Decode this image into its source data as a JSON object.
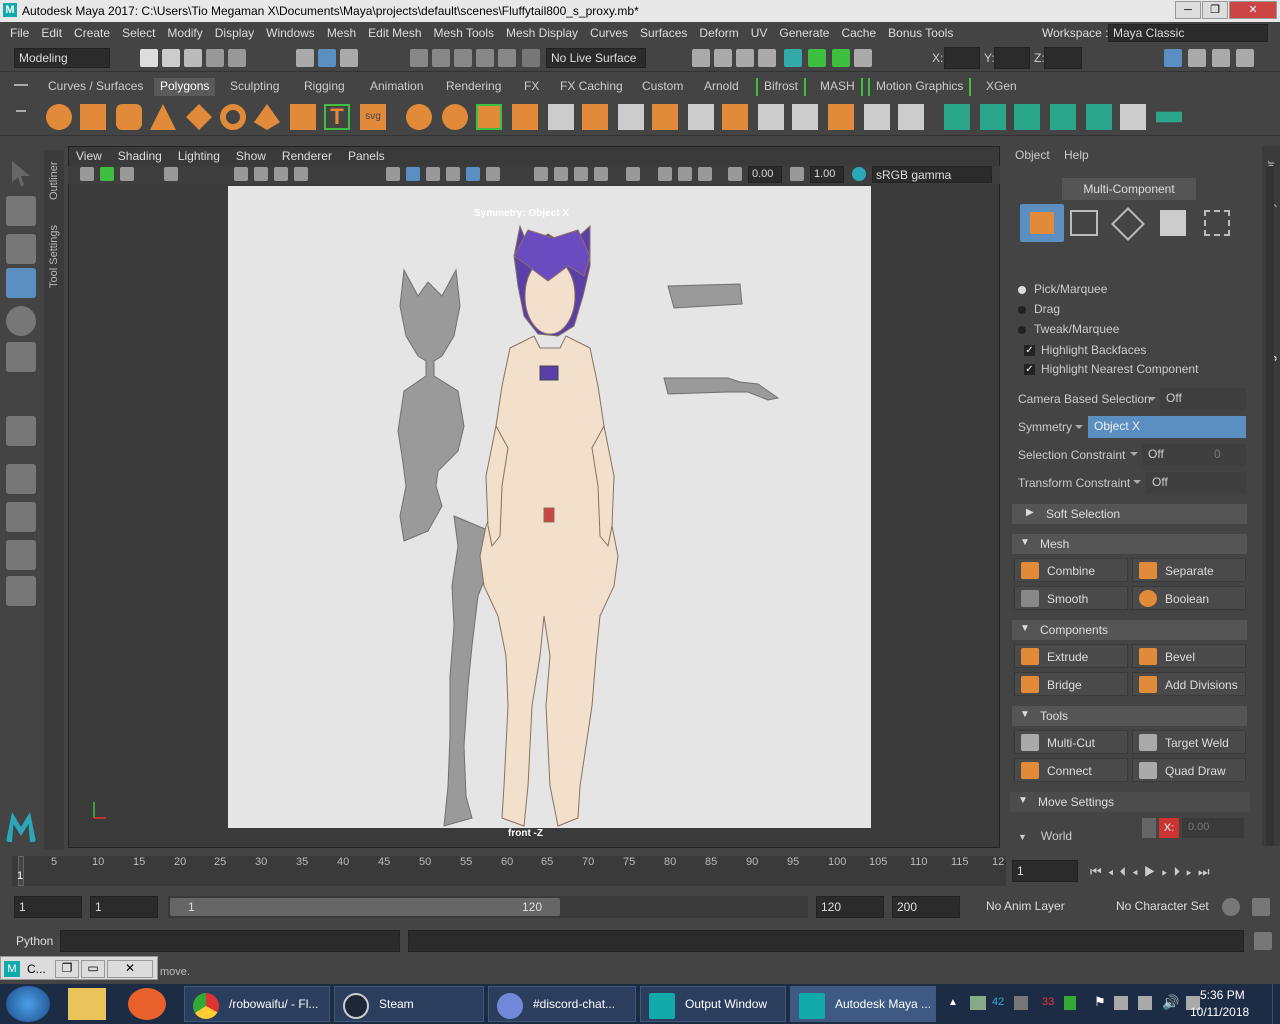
{
  "window": {
    "title": "Autodesk Maya 2017: C:\\Users\\Tio Megaman X\\Documents\\Maya\\projects\\default\\scenes\\Fluffytail800_s_proxy.mb*",
    "app_icon": "M"
  },
  "menu": [
    "File",
    "Edit",
    "Create",
    "Select",
    "Modify",
    "Display",
    "Windows",
    "Mesh",
    "Edit Mesh",
    "Mesh Tools",
    "Mesh Display",
    "Curves",
    "Surfaces",
    "Deform",
    "UV",
    "Generate",
    "Cache",
    "Bonus Tools"
  ],
  "workspace": {
    "label": "Workspace :",
    "value": "Maya Classic"
  },
  "status": {
    "mode": "Modeling",
    "live_surface": "No Live Surface",
    "x_label": "X:",
    "y_label": "Y:",
    "z_label": "Z:"
  },
  "shelf_tabs": [
    "Curves / Surfaces",
    "Polygons",
    "Sculpting",
    "Rigging",
    "Animation",
    "Rendering",
    "FX",
    "FX Caching",
    "Custom",
    "Arnold",
    "Bifrost",
    "MASH",
    "Motion Graphics",
    "XGen"
  ],
  "shelf_active": "Polygons",
  "side_tabs": {
    "outliner": "Outliner",
    "tool_settings": "Tool Settings"
  },
  "viewport": {
    "menu": [
      "View",
      "Shading",
      "Lighting",
      "Show",
      "Renderer",
      "Panels"
    ],
    "exposure": "0.00",
    "gamma": "1.00",
    "color_space": "sRGB gamma",
    "symmetry_hud": "Symmetry: Object X",
    "camera_label": "front -Z"
  },
  "right_panel": {
    "menu": [
      "Object",
      "Help"
    ],
    "multi_component": "Multi-Component",
    "pick_marquee": "Pick/Marquee",
    "drag": "Drag",
    "tweak_marquee": "Tweak/Marquee",
    "highlight_backfaces": "Highlight Backfaces",
    "highlight_nearest": "Highlight Nearest Component",
    "camera_based_label": "Camera Based Selection",
    "camera_based_value": "Off",
    "symmetry_label": "Symmetry",
    "symmetry_value": "Object X",
    "sel_constraint_label": "Selection Constraint",
    "sel_constraint_value": "Off",
    "sel_constraint_num": "0",
    "transform_constraint_label": "Transform Constraint",
    "transform_constraint_value": "Off",
    "soft_selection": "Soft Selection",
    "mesh_head": "Mesh",
    "combine": "Combine",
    "separate": "Separate",
    "smooth": "Smooth",
    "boolean": "Boolean",
    "components_head": "Components",
    "extrude": "Extrude",
    "bevel": "Bevel",
    "bridge": "Bridge",
    "add_divisions": "Add Divisions",
    "tools_head": "Tools",
    "multi_cut": "Multi-Cut",
    "target_weld": "Target Weld",
    "connect": "Connect",
    "quad_draw": "Quad Draw",
    "move_settings": "Move Settings",
    "world": "World",
    "x_axis": "X:",
    "x_value": "0.00"
  },
  "right_tabs": [
    "Channel Box / Layer Editor",
    "Modeling Toolkit",
    "Attribute Editor"
  ],
  "timeline": {
    "ticks": [
      "5",
      "10",
      "15",
      "20",
      "25",
      "30",
      "35",
      "40",
      "45",
      "50",
      "55",
      "60",
      "65",
      "70",
      "75",
      "80",
      "85",
      "90",
      "95",
      "100",
      "105",
      "110",
      "115",
      "12"
    ],
    "start_marker": "1",
    "current_frame": "1"
  },
  "range": {
    "start": "1",
    "playback_start": "1",
    "slider_start": "1",
    "slider_end": "120",
    "playback_end": "120",
    "end": "200",
    "anim_layer": "No Anim Layer",
    "char_set": "No Character Set"
  },
  "cmd": {
    "label": "Python"
  },
  "help_window": {
    "title": "C...",
    "text": "move."
  },
  "taskbar": {
    "items": [
      "/robowaifu/ - Fl...",
      "Steam",
      "#discord-chat...",
      "Output Window",
      "Autodesk Maya ..."
    ],
    "time": "5:36 PM",
    "date": "10/11/2018",
    "tray_nums": [
      "42",
      "33"
    ]
  },
  "colors": {
    "accent": "#5b8fc2",
    "orange": "#e08a3a",
    "green": "#3fbf3f"
  }
}
